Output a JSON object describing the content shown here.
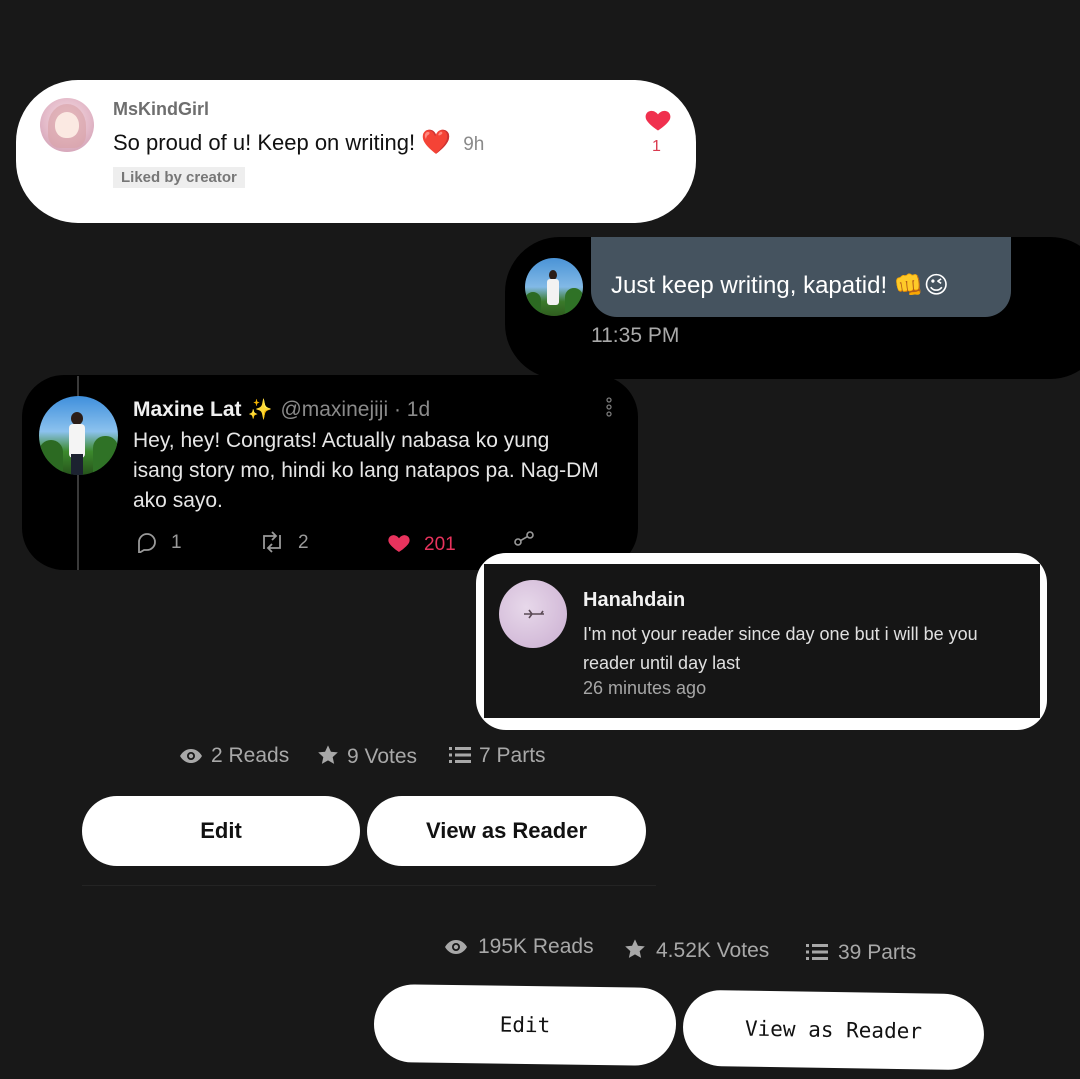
{
  "comment_card": {
    "username": "MsKindGirl",
    "text": "So proud of u! Keep on writing!",
    "emoji": "❤️",
    "time": "9h",
    "liked_label": "Liked by creator",
    "like_count": "1",
    "heart_color": "#f0304e"
  },
  "chat_card": {
    "message": "Just keep writing, kapatid! 👊😉",
    "time": "11:35 PM",
    "bubble_color": "#45535f"
  },
  "tweet_card": {
    "name": "Maxine Lat",
    "sparkle": "✨",
    "handle": "@maxinejiji · 1d",
    "text": "Hey, hey! Congrats! Actually nabasa ko yung isang story mo, hindi ko lang natapos pa. Nag-DM ako sayo.",
    "replies": "1",
    "retweets": "2",
    "likes": "201",
    "like_color": "#e8335d"
  },
  "reader_comment": {
    "username": "Hanahdain",
    "text": "I'm not your reader since day one but i will be you reader until day last",
    "time": "26 minutes ago"
  },
  "story_stats_1": {
    "reads": "2 Reads",
    "votes": "9 Votes",
    "parts": "7 Parts",
    "edit_label": "Edit",
    "view_label": "View as Reader"
  },
  "story_stats_2": {
    "reads": "195K Reads",
    "votes": "4.52K Votes",
    "parts": "39 Parts",
    "edit_label": "Edit",
    "view_label": "View as Reader"
  }
}
